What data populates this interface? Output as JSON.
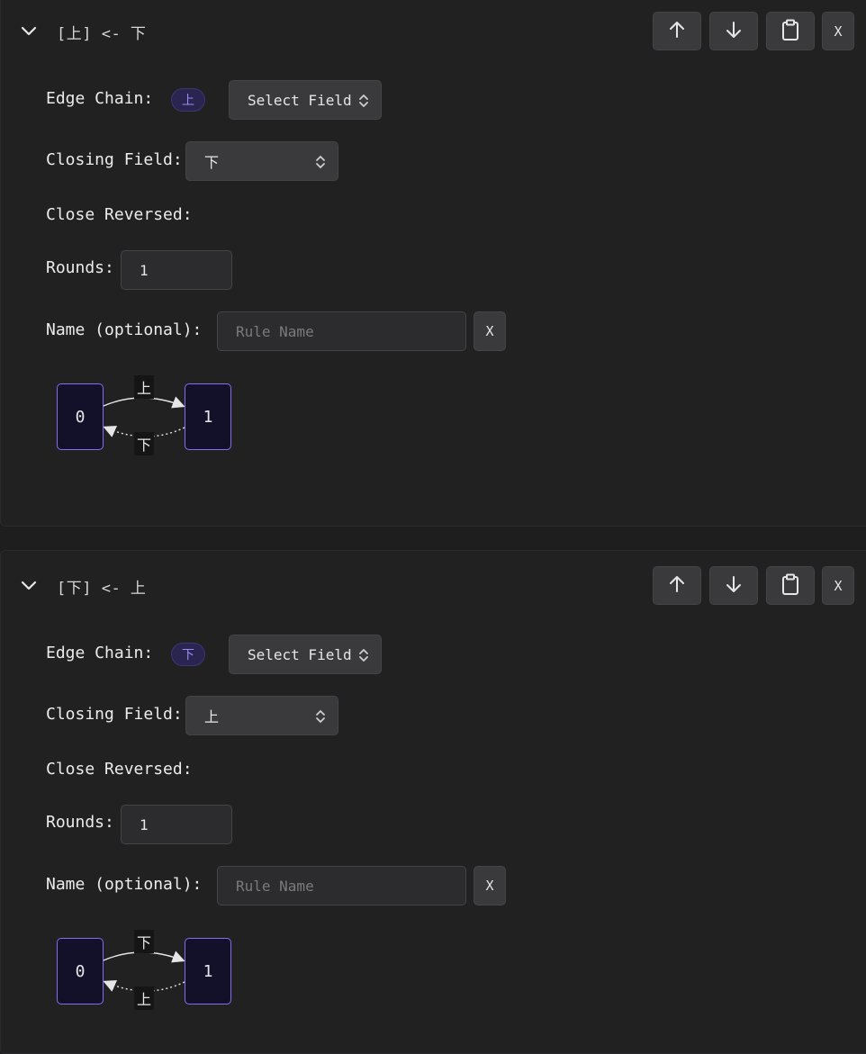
{
  "rules": [
    {
      "title": "[上] <- 下",
      "edge_chain_label": "Edge Chain:",
      "edge_chain_chip": "上",
      "edge_chain_select": "Select Field",
      "closing_field_label": "Closing Field:",
      "closing_field_value": "下",
      "close_reversed_label": "Close Reversed:",
      "rounds_label": "Rounds:",
      "rounds_value": "1",
      "name_label": "Name (optional):",
      "name_placeholder": "Rule Name",
      "name_value": "",
      "clear_label": "X",
      "remove_label": "X",
      "diagram": {
        "node_a": "0",
        "node_b": "1",
        "forward_label": "上",
        "closing_label": "下"
      }
    },
    {
      "title": "[下] <- 上",
      "edge_chain_label": "Edge Chain:",
      "edge_chain_chip": "下",
      "edge_chain_select": "Select Field",
      "closing_field_label": "Closing Field:",
      "closing_field_value": "上",
      "close_reversed_label": "Close Reversed:",
      "rounds_label": "Rounds:",
      "rounds_value": "1",
      "name_label": "Name (optional):",
      "name_placeholder": "Rule Name",
      "name_value": "",
      "clear_label": "X",
      "remove_label": "X",
      "diagram": {
        "node_a": "0",
        "node_b": "1",
        "forward_label": "下",
        "closing_label": "上"
      }
    }
  ],
  "icons": {
    "collapse": "chevron-down-icon",
    "move_up": "arrow-up-icon",
    "move_down": "arrow-down-icon",
    "copy": "clipboard-icon",
    "select": "chevron-up-down-icon"
  },
  "colors": {
    "background": "#1e1e1f",
    "panel": "#212122",
    "button": "#3a3a3c",
    "accent": "#8a6cf0",
    "chip_bg": "#2a2550",
    "chip_text": "#9d8cf0",
    "node_bg": "#13112a"
  }
}
